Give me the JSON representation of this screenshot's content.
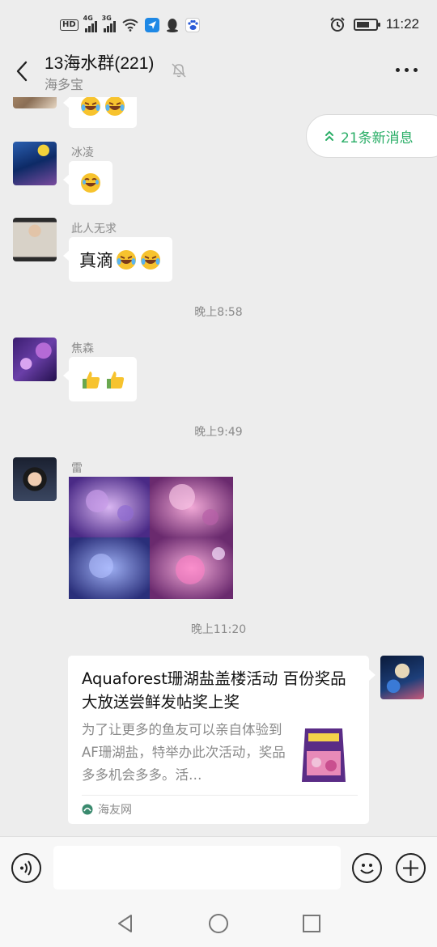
{
  "status_bar": {
    "hd_label": "HD",
    "signal1_label": "4G",
    "signal2_label": "3G",
    "time": "11:22",
    "battery_level": 0.7,
    "icons": [
      "hd-icon",
      "signal-4g-icon",
      "signal-3g-icon",
      "wifi-icon",
      "app-notification-icon",
      "qq-icon",
      "baidu-icon",
      "alarm-icon",
      "battery-icon"
    ]
  },
  "header": {
    "title": "13海水群(221)",
    "subtitle": "海多宝"
  },
  "new_messages": {
    "label": "21条新消息"
  },
  "messages": [
    {
      "sender": "冰凌",
      "text": ""
    },
    {
      "sender": "此人无求",
      "text": "真滴"
    },
    {
      "timestamp": "晚上8:58"
    },
    {
      "sender": "焦森",
      "text": ""
    },
    {
      "timestamp": "晚上9:49"
    },
    {
      "sender": "雷"
    },
    {
      "timestamp": "晚上11:20"
    }
  ],
  "link_card": {
    "title": "Aquaforest珊湖盐盖楼活动 百份奖品大放送尝鲜发帖奖上奖",
    "description": "为了让更多的鱼友可以亲自体验到AF珊湖盐，特举办此次活动，奖品多多机会多多。活…",
    "source": "海友网"
  },
  "input": {
    "value": "",
    "placeholder": ""
  },
  "colors": {
    "accent_green": "#2aae67",
    "background": "#ededed"
  }
}
